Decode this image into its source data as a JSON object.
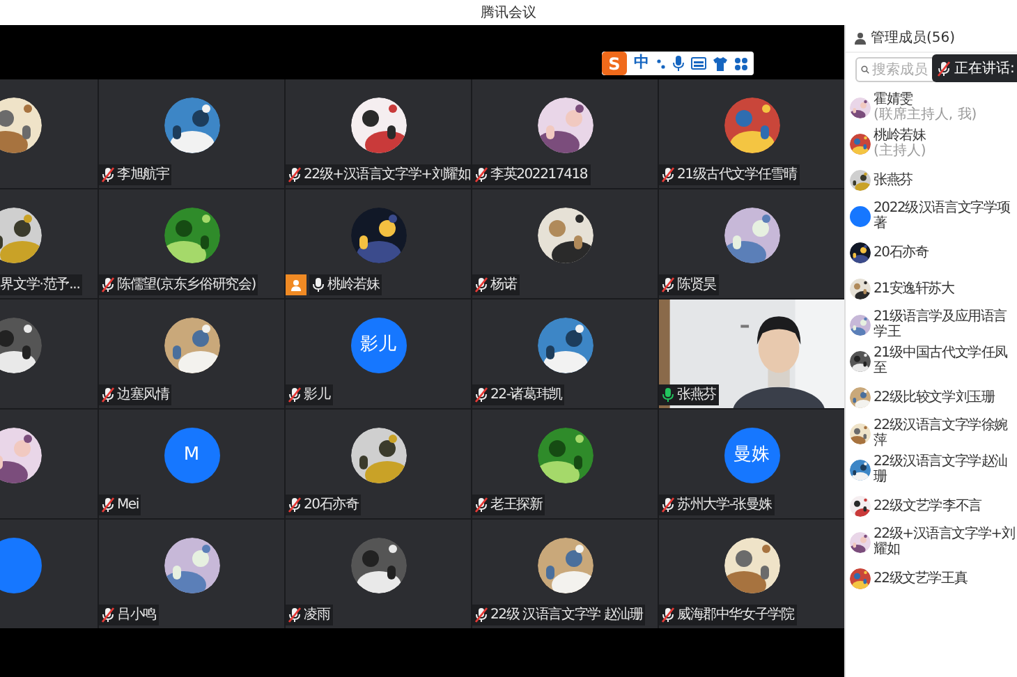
{
  "window": {
    "title": "腾讯会议"
  },
  "ime_toolbar": {
    "logo": "S",
    "mode": "中"
  },
  "grid": {
    "edge_column": [
      {
        "avatar": {
          "kind": "picture"
        }
      },
      {
        "name": "界文学·范予...",
        "avatar": {
          "kind": "picture"
        }
      },
      {
        "avatar": {
          "kind": "picture"
        }
      },
      {
        "avatar": {
          "kind": "picture"
        }
      },
      {
        "avatar": {
          "kind": "plain"
        }
      }
    ],
    "rows": [
      [
        {
          "name": "李旭航宇",
          "muted": true,
          "speaking": false,
          "avatar": {
            "kind": "picture"
          }
        },
        {
          "name": "22级+汉语言文字学+刘耀如",
          "muted": true,
          "speaking": false,
          "avatar": {
            "kind": "picture"
          }
        },
        {
          "name": "李英202217418",
          "muted": true,
          "speaking": false,
          "avatar": {
            "kind": "picture"
          }
        },
        {
          "name": "21级古代文学任雪晴",
          "muted": true,
          "speaking": false,
          "avatar": {
            "kind": "picture"
          }
        }
      ],
      [
        {
          "name": "陈儒望(京东乡俗研究会)",
          "muted": true,
          "speaking": false,
          "avatar": {
            "kind": "picture"
          }
        },
        {
          "name": "桃岭若妹",
          "muted": false,
          "speaking": false,
          "host": true,
          "avatar": {
            "kind": "picture"
          }
        },
        {
          "name": "杨诺",
          "muted": true,
          "speaking": false,
          "avatar": {
            "kind": "picture"
          }
        },
        {
          "name": "陈贤昊",
          "muted": true,
          "speaking": false,
          "avatar": {
            "kind": "picture"
          }
        }
      ],
      [
        {
          "name": "边塞风情",
          "muted": true,
          "speaking": false,
          "avatar": {
            "kind": "picture"
          }
        },
        {
          "name": "影儿",
          "muted": true,
          "speaking": false,
          "avatar": {
            "kind": "initials",
            "text": "影儿"
          }
        },
        {
          "name": "22-诸葛玮凯",
          "muted": true,
          "speaking": false,
          "avatar": {
            "kind": "picture"
          }
        },
        {
          "name": "张燕芬",
          "muted": false,
          "speaking": true,
          "avatar": {
            "kind": "video"
          }
        }
      ],
      [
        {
          "name": "Mei",
          "muted": true,
          "speaking": false,
          "avatar": {
            "kind": "initials",
            "text": "M"
          }
        },
        {
          "name": "20石亦奇",
          "muted": true,
          "speaking": false,
          "avatar": {
            "kind": "picture"
          }
        },
        {
          "name": "老王探新",
          "muted": true,
          "speaking": false,
          "avatar": {
            "kind": "picture"
          }
        },
        {
          "name": "苏州大学-张曼姝",
          "muted": true,
          "speaking": false,
          "avatar": {
            "kind": "initials",
            "text": "曼姝"
          }
        }
      ],
      [
        {
          "name": "吕小鸣",
          "muted": true,
          "speaking": false,
          "avatar": {
            "kind": "picture"
          }
        },
        {
          "name": "凌雨",
          "muted": true,
          "speaking": false,
          "avatar": {
            "kind": "picture"
          }
        },
        {
          "name": "22级 汉语言文字学 赵汕珊",
          "muted": true,
          "speaking": false,
          "avatar": {
            "kind": "picture"
          }
        },
        {
          "name": "威海郡中华女子学院",
          "muted": true,
          "speaking": false,
          "avatar": {
            "kind": "picture"
          }
        }
      ]
    ]
  },
  "members_panel": {
    "title": "管理成员(56)",
    "search": {
      "placeholder": "搜索成员"
    },
    "tooltip": "正在讲话:",
    "members": [
      {
        "name": "霍婧雯",
        "role": "(联席主持人, 我)",
        "avatar": {
          "kind": "picture"
        }
      },
      {
        "name": "桃岭若妹",
        "role": "(主持人)",
        "avatar": {
          "kind": "picture"
        }
      },
      {
        "name": "张燕芬",
        "avatar": {
          "kind": "picture"
        }
      },
      {
        "name": "2022级 汉语言文字学 项著",
        "avatar": {
          "kind": "plain"
        }
      },
      {
        "name": "20石亦奇",
        "avatar": {
          "kind": "picture"
        }
      },
      {
        "name": "21安逸轩苏大",
        "avatar": {
          "kind": "picture"
        }
      },
      {
        "name": "21级 语言学及应用语言学 王",
        "avatar": {
          "kind": "picture"
        }
      },
      {
        "name": "21级 中国古代文学 任凤至",
        "avatar": {
          "kind": "picture"
        }
      },
      {
        "name": "22级 比较文学 刘玉珊",
        "avatar": {
          "kind": "picture"
        }
      },
      {
        "name": "22级 汉语言文字学 徐婉萍",
        "avatar": {
          "kind": "picture"
        }
      },
      {
        "name": "22级 汉语言文字学 赵汕珊",
        "avatar": {
          "kind": "picture"
        }
      },
      {
        "name": "22级 文艺学 李不言",
        "avatar": {
          "kind": "picture"
        }
      },
      {
        "name": "22级+汉语言文字学+刘耀如",
        "avatar": {
          "kind": "picture"
        }
      },
      {
        "name": "22级文艺学王真",
        "avatar": {
          "kind": "picture"
        }
      }
    ]
  }
}
